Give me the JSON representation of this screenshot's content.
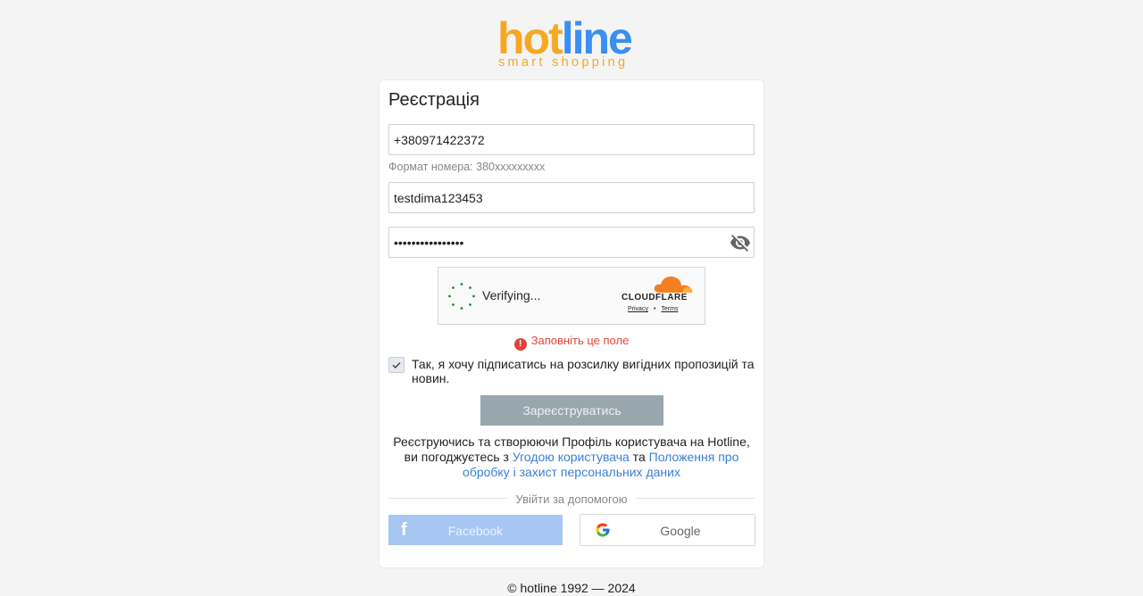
{
  "logo": {
    "main_hot": "hot",
    "main_line": "line",
    "tagline": "smart shopping"
  },
  "form": {
    "title": "Реєстрація",
    "phone_value": "+380971422372",
    "phone_hint": "Формат номера: 380xxxxxxxxx",
    "login_value": "testdima123453",
    "password_value": "••••••••••••••••",
    "password_icon": "eye-off-icon"
  },
  "captcha": {
    "status": "Verifying...",
    "brand": "CLOUDFLARE",
    "privacy": "Privacy",
    "separator": "•",
    "terms": "Terms"
  },
  "error": {
    "text": "Заповніть це поле",
    "color": "#e0453a"
  },
  "newsletter": {
    "label": "Так, я хочу підписатись на розсилку вигідних пропозицій та новин.",
    "checked": true
  },
  "submit_label": "Зареєструватись",
  "terms": {
    "text1": "Реєструючись та створюючи Профіль користувача на Hotline, ви погоджуєтесь з ",
    "link1": "Угодою користувача",
    "text2": " та ",
    "link2": "Положення про обробку і захист персональних даних"
  },
  "social": {
    "separator": "Увійти за допомогою",
    "facebook_label": "Facebook",
    "google_label": "Google"
  },
  "footer": "© hotline 1992 — 2024",
  "colors": {
    "brand_orange": "#f7a823",
    "brand_blue": "#3a8ff1",
    "link": "#3a7fd5",
    "facebook": "#a7c7f3"
  }
}
